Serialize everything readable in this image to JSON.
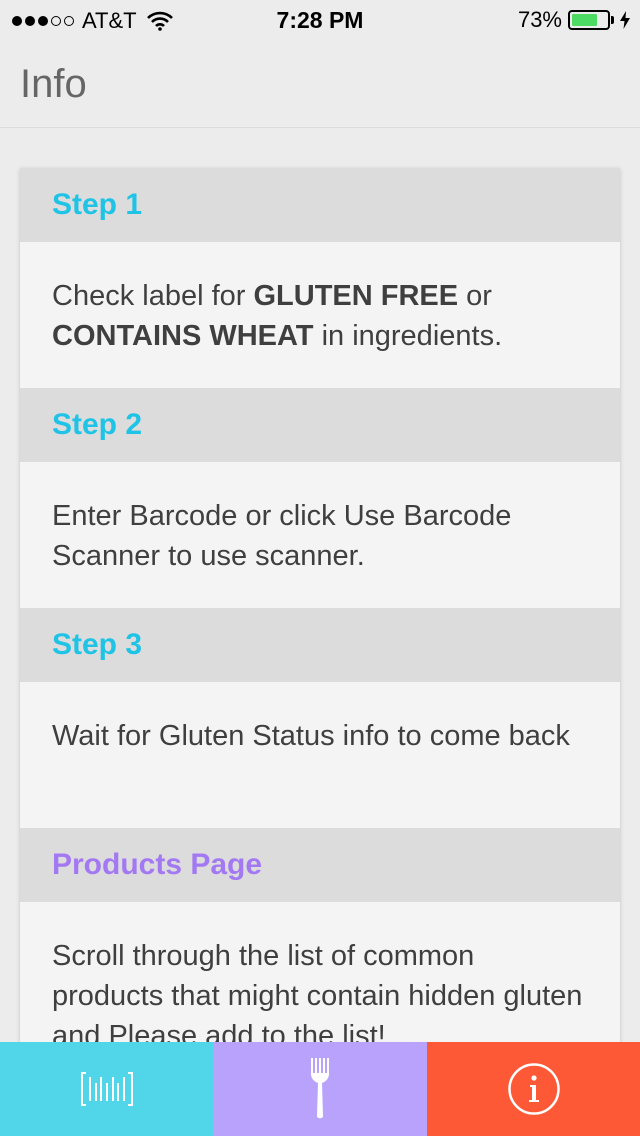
{
  "status_bar": {
    "signal_dots_filled": 3,
    "signal_dots_total": 5,
    "carrier": "AT&T",
    "time": "7:28 PM",
    "battery_percent": "73%",
    "battery_level": 0.73,
    "battery_color": "#4cd964"
  },
  "nav": {
    "title": "Info"
  },
  "sections": [
    {
      "heading": "Step 1",
      "body_parts": [
        "Check label for ",
        "GLUTEN FREE",
        " or ",
        "CONTAINS WHEAT",
        " in ingredients."
      ]
    },
    {
      "heading": "Step 2",
      "body": "Enter Barcode or click Use Barcode Scanner to use scanner."
    },
    {
      "heading": "Step 3",
      "body": "Wait for Gluten Status info to come back"
    },
    {
      "heading": "Products Page",
      "body": "Scroll through the list of common products that might contain hidden gluten and Please add to the list!"
    }
  ],
  "colors": {
    "step_heading": "#1ec3e6",
    "products_heading": "#a379f3",
    "tab_scan": "#51d5e9",
    "tab_food": "#b8a2fb",
    "tab_info": "#fe5937"
  },
  "tabbar": {
    "tabs": [
      {
        "icon": "barcode-icon"
      },
      {
        "icon": "fork-icon"
      },
      {
        "icon": "info-icon"
      }
    ]
  }
}
